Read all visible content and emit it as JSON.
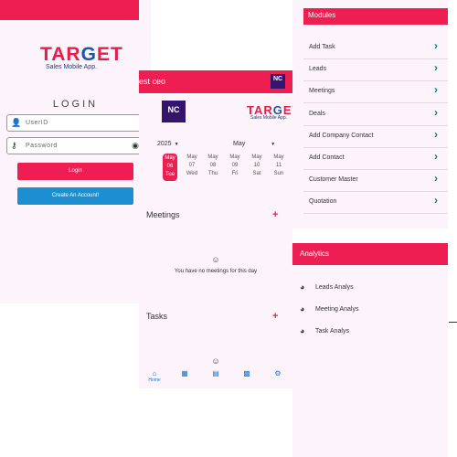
{
  "brand": {
    "logo_t": "TAR",
    "logo_g": "G",
    "logo_et": "ET",
    "tagline": "Sales Mobile App.",
    "nc_logo": "NC",
    "nc_small": "NC"
  },
  "login": {
    "title": "LOGIN",
    "userid_placeholder": "UserID",
    "password_placeholder": "Password",
    "login_label": "Login",
    "create_label": "Create An Account!"
  },
  "dashboard": {
    "header_title": "est ceo",
    "year": "2025",
    "month": "May",
    "days": [
      {
        "month": "May",
        "date": "06",
        "weekday": "Tue",
        "active": true
      },
      {
        "month": "May",
        "date": "07",
        "weekday": "Wed",
        "active": false
      },
      {
        "month": "May",
        "date": "08",
        "weekday": "Thu",
        "active": false
      },
      {
        "month": "May",
        "date": "09",
        "weekday": "Fri",
        "active": false
      },
      {
        "month": "May",
        "date": "10",
        "weekday": "Sat",
        "active": false
      },
      {
        "month": "May",
        "date": "11",
        "weekday": "Sun",
        "active": false
      }
    ],
    "meetings_title": "Meetings",
    "meetings_empty": "You have no meetings for this day",
    "tasks_title": "Tasks",
    "nav": {
      "home_label": "Home",
      "icons": [
        "home-icon",
        "grid-icon",
        "document-icon",
        "bar-chart-icon",
        "settings-icon"
      ]
    }
  },
  "modules": {
    "title": "Modules",
    "items": [
      "Add Task",
      "Leads",
      "Meetings",
      "Deals",
      "Add Company Contact",
      "Add Contact",
      "Customer Master",
      "Quotation"
    ]
  },
  "analytics": {
    "title": "Analytics",
    "items": [
      "Leads Analys",
      "Meeting Analys",
      "Task Analys"
    ]
  },
  "colors": {
    "accent": "#ee1d52",
    "blue_button": "#1b8fcf",
    "chevron": "#00897b",
    "panel_bg": "#fdf3fb"
  }
}
